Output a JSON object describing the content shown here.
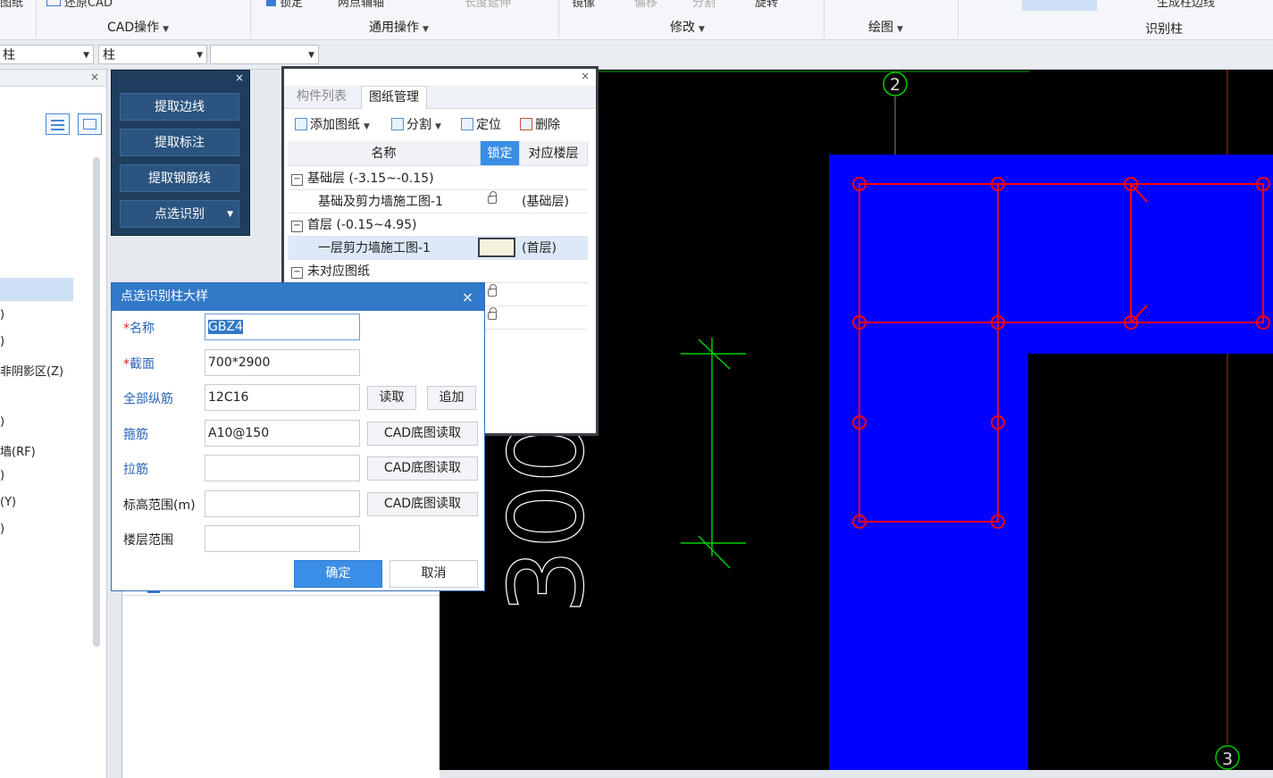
{
  "ribbon": {
    "cut_top_left": "图纸",
    "cut_restore": "还原CAD",
    "cut_lock": "锁定",
    "cut_twopoint": "两点辅轴",
    "cut_extend": "长度延伸",
    "cut_mirror": "镜像",
    "cut_move": "偏移",
    "cut_split": "分割",
    "cut_rotate": "旋转",
    "cut_gen_edge": "生成柱边线",
    "groups": {
      "cad_ops": "CAD操作",
      "common_ops": "通用操作",
      "modify": "修改",
      "draw": "绘图",
      "recognize_column": "识别柱"
    }
  },
  "selectors": {
    "s1": "柱",
    "s2": "柱",
    "s3": ""
  },
  "left_panel": {
    "items": [
      ")",
      ")",
      "非阴影区(Z)",
      ")",
      "墙(RF)",
      ")",
      "(Y)",
      ")"
    ]
  },
  "extract_panel": {
    "extract_edge": "提取边线",
    "extract_label": "提取标注",
    "extract_rebar": "提取钢筋线",
    "point_recognize": "点选识别"
  },
  "drawing_manager": {
    "tab_components": "构件列表",
    "tab_drawings": "图纸管理",
    "toolbar": {
      "add": "添加图纸",
      "split": "分割",
      "locate": "定位",
      "delete": "删除"
    },
    "headers": {
      "name": "名称",
      "lock": "锁定",
      "floor": "对应楼层"
    },
    "rows": [
      {
        "name": "基础层 (-3.15~-0.15)",
        "floor": ""
      },
      {
        "name": "基础及剪力墙施工图-1",
        "floor": "(基础层)"
      },
      {
        "name": "首层 (-0.15~4.95)",
        "floor": ""
      },
      {
        "name": "一层剪力墙施工图-1",
        "floor": "(首层)"
      },
      {
        "name": "未对应图纸",
        "floor": ""
      }
    ]
  },
  "dialog": {
    "title": "点选识别柱大样",
    "labels": {
      "name": "名称",
      "section": "截面",
      "all_long_rebar": "全部纵筋",
      "stirrup": "箍筋",
      "tie": "拉筋",
      "elevation": "标高范围(m)",
      "floor_range": "楼层范围"
    },
    "values": {
      "name": "GBZ4",
      "section": "700*2900",
      "all_long_rebar": "12C16",
      "stirrup": "A10@150",
      "tie": "",
      "elevation": "",
      "floor_range": ""
    },
    "buttons": {
      "read": "读取",
      "append": "追加",
      "cad_read_1": "CAD底图读取",
      "cad_read_2": "CAD底图读取",
      "cad_read_3": "CAD底图读取",
      "ok": "确定",
      "cancel": "取消"
    }
  },
  "canvas": {
    "axis_2": "2",
    "axis_3": "3",
    "dim_text": "300",
    "colors": {
      "background": "#000000",
      "column_fill": "#0000ff",
      "rebar": "#ff0000",
      "dimension": "#00cc00",
      "axis": "#888888"
    }
  }
}
